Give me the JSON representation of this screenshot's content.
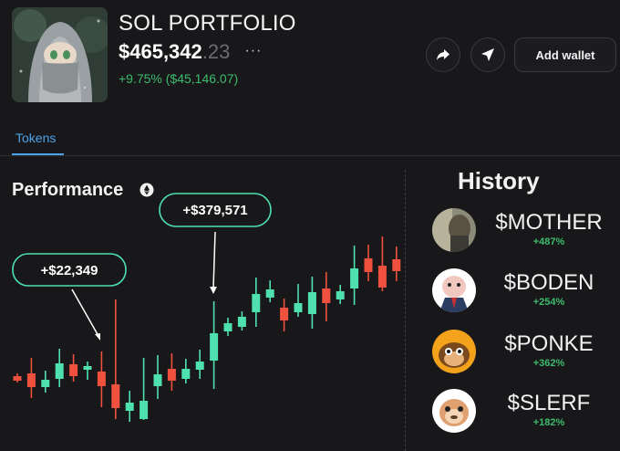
{
  "header": {
    "title": "SOL PORTFOLIO",
    "balance_main": "$465,342",
    "balance_cents": ".23",
    "more_label": "···",
    "change": "+9.75% ($45,146.07)"
  },
  "actions": {
    "share_icon": "share-arrow-icon",
    "send_icon": "send-arrow-icon",
    "add_wallet_label": "Add wallet"
  },
  "tabs": [
    {
      "label": "Tokens",
      "active": true
    }
  ],
  "performance": {
    "title": "Performance",
    "icon": "eth-diamond-icon",
    "callouts": [
      {
        "label": "+$22,349"
      },
      {
        "label": "+$379,571"
      }
    ]
  },
  "chart_data": {
    "type": "candlestick",
    "up_color": "#4fe0b0",
    "down_color": "#f0513e",
    "candles": [
      {
        "o": 412,
        "c": 417,
        "h": 409,
        "l": 419
      },
      {
        "o": 409,
        "c": 424,
        "h": 392,
        "l": 436
      },
      {
        "o": 424,
        "c": 416,
        "h": 406,
        "l": 430
      },
      {
        "o": 415,
        "c": 398,
        "h": 382,
        "l": 424
      },
      {
        "o": 399,
        "c": 412,
        "h": 388,
        "l": 418
      },
      {
        "o": 405,
        "c": 401,
        "h": 396,
        "l": 416
      },
      {
        "o": 407,
        "c": 423,
        "h": 385,
        "l": 446
      },
      {
        "o": 421,
        "c": 447,
        "h": 328,
        "l": 459
      },
      {
        "o": 450,
        "c": 441,
        "h": 428,
        "l": 462
      },
      {
        "o": 459,
        "c": 439,
        "h": 392,
        "l": 460
      },
      {
        "o": 423,
        "c": 410,
        "h": 389,
        "l": 437
      },
      {
        "o": 404,
        "c": 417,
        "h": 387,
        "l": 428
      },
      {
        "o": 415,
        "c": 404,
        "h": 393,
        "l": 420
      },
      {
        "o": 405,
        "c": 396,
        "h": 383,
        "l": 415
      },
      {
        "o": 395,
        "c": 365,
        "h": 330,
        "l": 426
      },
      {
        "o": 363,
        "c": 354,
        "h": 348,
        "l": 368
      },
      {
        "o": 358,
        "c": 347,
        "h": 341,
        "l": 362
      },
      {
        "o": 342,
        "c": 322,
        "h": 304,
        "l": 358
      },
      {
        "o": 326,
        "c": 317,
        "h": 307,
        "l": 331
      },
      {
        "o": 337,
        "c": 351,
        "h": 327,
        "l": 363
      },
      {
        "o": 342,
        "c": 332,
        "h": 311,
        "l": 347
      },
      {
        "o": 344,
        "c": 320,
        "h": 303,
        "l": 360
      },
      {
        "o": 316,
        "c": 332,
        "h": 298,
        "l": 352
      },
      {
        "o": 328,
        "c": 319,
        "h": 312,
        "l": 333
      },
      {
        "o": 316,
        "c": 294,
        "h": 269,
        "l": 334
      },
      {
        "o": 283,
        "c": 298,
        "h": 268,
        "l": 308
      },
      {
        "o": 291,
        "c": 315,
        "h": 259,
        "l": 319
      },
      {
        "o": 284,
        "c": 297,
        "h": 270,
        "l": 308
      }
    ],
    "annotations": [
      {
        "label": "+$22,349"
      },
      {
        "label": "+$379,571"
      }
    ]
  },
  "history": {
    "title": "History",
    "items": [
      {
        "name": "$MOTHER",
        "change": "+487%",
        "avatar_icon": "mother-avatar"
      },
      {
        "name": "$BODEN",
        "change": "+254%",
        "avatar_icon": "boden-avatar"
      },
      {
        "name": "$PONKE",
        "change": "+362%",
        "avatar_icon": "ponke-avatar"
      },
      {
        "name": "$SLERF",
        "change": "+182%",
        "avatar_icon": "slerf-avatar"
      }
    ]
  },
  "colors": {
    "background": "#18181b",
    "accent_blue": "#4aa3e8",
    "positive_green": "#3dbb6d",
    "callout_border": "#4fe0b0"
  }
}
